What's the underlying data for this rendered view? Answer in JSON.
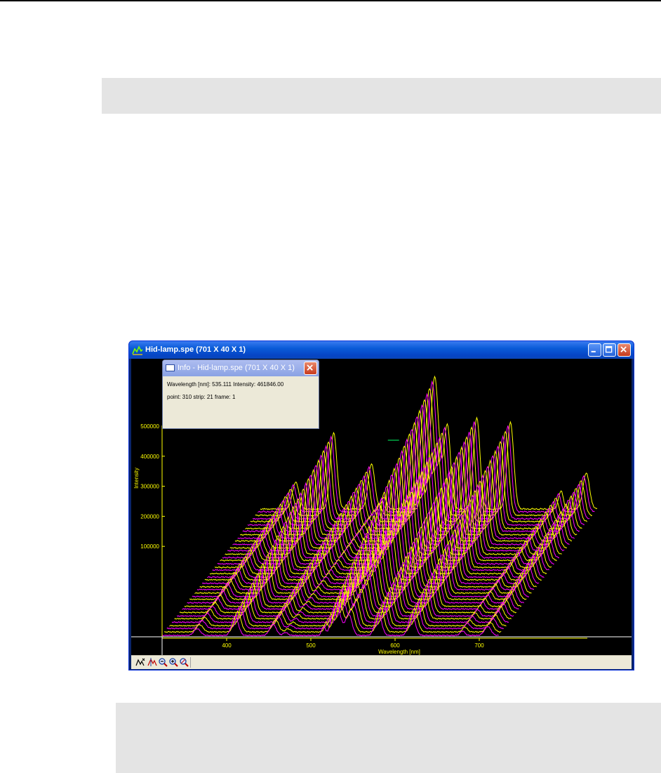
{
  "window": {
    "title": "Hid-lamp.spe (701 X 40 X 1)"
  },
  "info_panel": {
    "title": "Info - Hid-lamp.spe (701 X 40 X 1)",
    "line1": "Wavelength [nm]: 535.111   Intensity: 461846.00",
    "line2": "point: 310  strip: 21  frame: 1"
  },
  "chart_data": {
    "type": "line",
    "render_style": "3d-waterfall stacked spectra, 40 strips, alternating magenta and yellow traces",
    "xlabel": "Wavelength [nm]",
    "ylabel": "Intensity",
    "x_ticks": [
      "400",
      "500",
      "600",
      "700"
    ],
    "y_ticks": [
      "100000",
      "200000",
      "300000",
      "400000",
      "500000"
    ],
    "strip_count": 40,
    "series_colors": [
      "#ff00ff",
      "#ffff00"
    ],
    "peaks": [
      {
        "x": 365,
        "y": 90000
      },
      {
        "x": 410,
        "y": 255000
      },
      {
        "x": 455,
        "y": 150000
      },
      {
        "x": 530,
        "y": 440000
      },
      {
        "x": 545,
        "y": 280000
      },
      {
        "x": 580,
        "y": 305000
      },
      {
        "x": 620,
        "y": 290000
      },
      {
        "x": 710,
        "y": 120000
      }
    ],
    "cursor": {
      "x": 535.111,
      "y": 461846.0,
      "strip": 21
    }
  },
  "toolbar": {
    "buttons": [
      {
        "name": "auto-scale-icon"
      },
      {
        "name": "peak-icon"
      },
      {
        "name": "zoom-out-icon"
      },
      {
        "name": "zoom-in-icon"
      },
      {
        "name": "zoom-reset-icon"
      }
    ]
  }
}
